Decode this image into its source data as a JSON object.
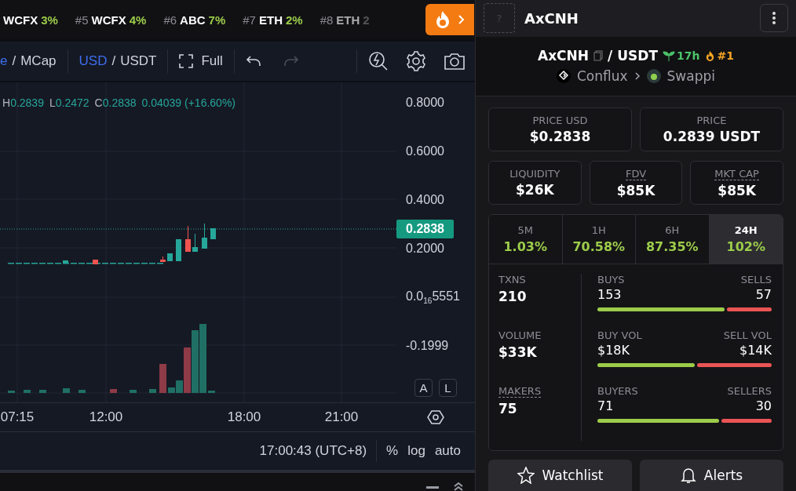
{
  "ticker": [
    {
      "symbol": "WCFX",
      "change": "3%"
    },
    {
      "rank": "#5",
      "symbol": "WCFX",
      "change": "4%"
    },
    {
      "rank": "#6",
      "symbol": "ABC",
      "change": "7%"
    },
    {
      "rank": "#7",
      "symbol": "ETH",
      "change": "2%"
    },
    {
      "rank": "#8",
      "symbol": "ETH",
      "change": "2"
    }
  ],
  "toolbar": {
    "price_modes": [
      {
        "label": "e",
        "selected": true
      },
      {
        "separator": "/",
        "label": "MCap",
        "selected": false
      }
    ],
    "currencies": [
      {
        "label": "USD",
        "selected": true
      },
      {
        "separator": "/",
        "label": "USDT",
        "selected": false
      }
    ],
    "full_label": "Full",
    "redo_disabled": true
  },
  "legend": [
    {
      "key": "H",
      "value": "0.2839"
    },
    {
      "key": "L",
      "value": "0.2472"
    },
    {
      "key": "C",
      "value": "0.2838"
    },
    {
      "value": "0.04039 (+16.60%)"
    }
  ],
  "y_axis": [
    {
      "text": "0.8000",
      "kind": "tick"
    },
    {
      "text": "0.6000",
      "kind": "tick"
    },
    {
      "text": "0.4000",
      "kind": "tick"
    },
    {
      "text": "0.2838",
      "kind": "current"
    },
    {
      "text": "0.2000",
      "kind": "tick"
    },
    {
      "text": "0.0$_{16}$5551",
      "kind": "tick"
    },
    {
      "text": "-0.1999",
      "kind": "tick"
    }
  ],
  "scale_buttons": [
    "A",
    "L"
  ],
  "x_axis": [
    "07:15",
    "12:00",
    "18:00",
    "21:00"
  ],
  "bottom_bar": {
    "time": "17:00:43 (UTC+8)",
    "options": [
      "%",
      "log",
      "auto"
    ]
  },
  "header": {
    "token_placeholder": "?",
    "title": "AxCNH"
  },
  "pair": {
    "base": "AxCNH",
    "separator": "/",
    "quote": "USDT",
    "age": "17h",
    "rank": "#1",
    "chain": "Conflux",
    "dex": "Swappi"
  },
  "price_cards": [
    {
      "label": "PRICE USD",
      "value": "$0.2838"
    },
    {
      "label": "PRICE",
      "value": "0.2839 USDT"
    }
  ],
  "metric_cards": [
    {
      "label": "LIQUIDITY",
      "value": "$26K",
      "hint": false
    },
    {
      "label": "FDV",
      "value": "$85K",
      "hint": true
    },
    {
      "label": "MKT CAP",
      "value": "$85K",
      "hint": true
    }
  ],
  "timeframes": [
    {
      "label": "5M",
      "change": "1.03%",
      "selected": false
    },
    {
      "label": "1H",
      "change": "70.58%",
      "selected": false
    },
    {
      "label": "6H",
      "change": "87.35%",
      "selected": false
    },
    {
      "label": "24H",
      "change": "102%",
      "selected": true
    }
  ],
  "stats": [
    {
      "label": "TXNS",
      "value": "210",
      "hint": false,
      "left_label": "BUYS",
      "left_value": "153",
      "right_label": "SELLS",
      "right_value": "57",
      "level": 0.73
    },
    {
      "label": "VOLUME",
      "value": "$33K",
      "hint": false,
      "left_label": "BUY VOL",
      "left_value": "$18K",
      "right_label": "SELL VOL",
      "right_value": "$14K",
      "level": 0.56
    },
    {
      "label": "MAKERS",
      "value": "75",
      "hint": true,
      "left_label": "BUYERS",
      "left_value": "71",
      "right_label": "SELLERS",
      "right_value": "30",
      "level": 0.7
    }
  ],
  "actions": [
    {
      "label": "Watchlist",
      "kind": "watchlist"
    },
    {
      "label": "Alerts",
      "kind": "alerts"
    }
  ]
}
